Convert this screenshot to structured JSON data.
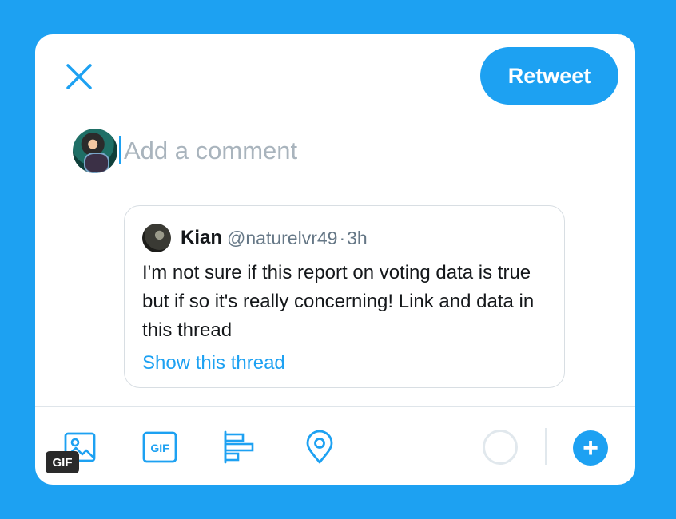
{
  "compose": {
    "retweet_label": "Retweet",
    "comment_placeholder": "Add a comment",
    "comment_value": ""
  },
  "quoted_tweet": {
    "name": "Kian",
    "handle": "@naturelvr49",
    "separator": "·",
    "time": "3h",
    "text": "I'm not sure if this report on voting data is true but if so it's really concerning! Link and data in this thread",
    "show_thread_label": "Show this thread"
  },
  "toolbar": {
    "items": [
      "image-icon",
      "gif-icon",
      "poll-icon",
      "location-icon"
    ],
    "gif_badge": "GIF",
    "add_label": "+"
  },
  "colors": {
    "brand": "#1da1f2",
    "text": "#14171a",
    "muted": "#657786",
    "placeholder": "#a9b4bd",
    "border": "#d8dee3"
  }
}
